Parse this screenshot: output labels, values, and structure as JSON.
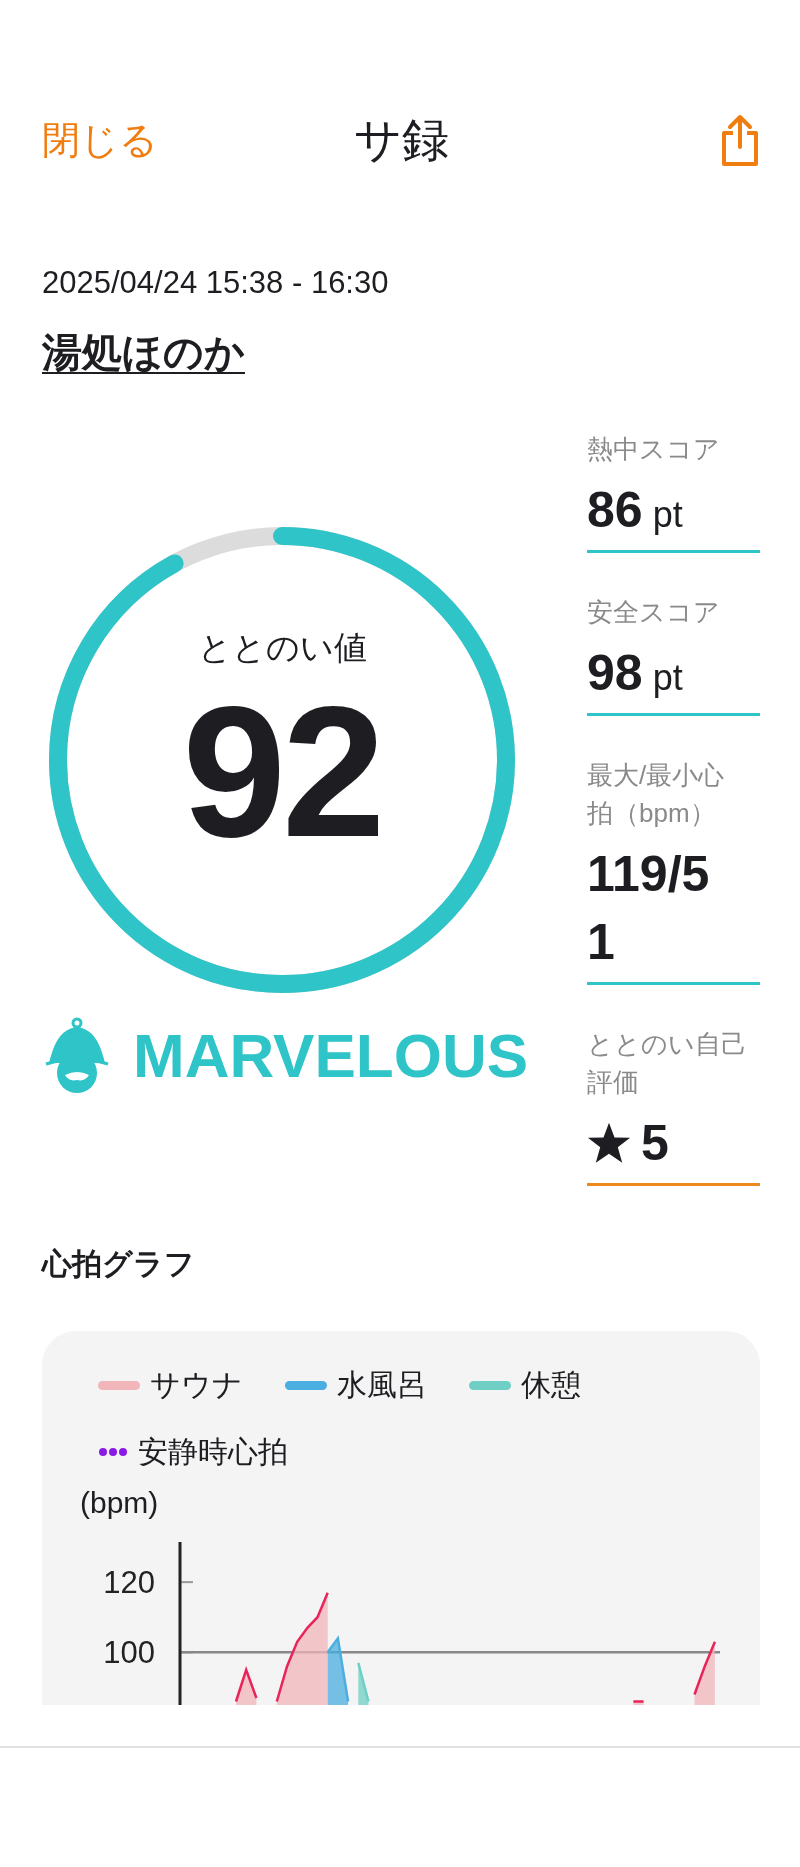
{
  "header": {
    "close": "閉じる",
    "title": "サ録"
  },
  "session": {
    "datetime": "2025/04/24 15:38 - 16:30",
    "venue": "湯処ほのか"
  },
  "score": {
    "label": "ととのい値",
    "value": "92",
    "level": 0.92,
    "rank": "MARVELOUS"
  },
  "stats": [
    {
      "kind": "score",
      "label": "熱中スコア",
      "value": "86",
      "unit": "pt"
    },
    {
      "kind": "score",
      "label": "安全スコア",
      "value": "98",
      "unit": "pt"
    },
    {
      "kind": "score",
      "label": "最大/最小心拍（bpm）",
      "value": "119/51"
    },
    {
      "kind": "rating",
      "label": "ととのい自己評価",
      "value": "5"
    }
  ],
  "heart_graph": {
    "title": "心拍グラフ",
    "chart_data": {
      "type": "area",
      "ylabel": "(bpm)",
      "ylim": [
        85,
        132
      ],
      "yticks": [
        {
          "value": 100,
          "label": "100"
        },
        {
          "value": 120,
          "label": "120"
        }
      ],
      "legend": "top",
      "series": [
        {
          "name": "サウナ",
          "color": "#f0b6ba",
          "values": [
            null,
            null,
            null,
            null,
            null,
            86,
            95,
            87,
            null,
            86,
            96,
            103,
            107,
            110,
            117,
            null,
            null,
            null,
            null,
            null,
            null,
            null,
            null,
            null,
            null,
            null,
            null,
            null,
            null,
            null,
            null,
            null,
            null,
            null,
            null,
            null,
            null,
            null,
            null,
            null,
            null,
            null,
            null,
            null,
            86,
            86,
            null,
            null,
            null,
            null,
            88,
            96,
            103
          ]
        },
        {
          "name": "水風呂",
          "color": "#4aaee0",
          "values": [
            null,
            null,
            null,
            null,
            null,
            null,
            null,
            null,
            null,
            null,
            null,
            null,
            null,
            null,
            100,
            104,
            86,
            null,
            null,
            null,
            null,
            null,
            null,
            null,
            null,
            null,
            null,
            null,
            null,
            null,
            null,
            null,
            null,
            null,
            null,
            null,
            null,
            null,
            null,
            null,
            null,
            null,
            null,
            null,
            null,
            null,
            null,
            null,
            null,
            null,
            null,
            null,
            null
          ]
        },
        {
          "name": "休憩",
          "color": "#6fcfc4",
          "values": [
            null,
            null,
            null,
            null,
            null,
            null,
            null,
            null,
            null,
            null,
            null,
            null,
            null,
            null,
            null,
            null,
            null,
            97,
            86,
            null,
            null,
            null,
            null,
            null,
            null,
            null,
            null,
            null,
            null,
            null,
            null,
            null,
            null,
            null,
            null,
            null,
            null,
            null,
            null,
            null,
            null,
            null,
            null,
            null,
            null,
            null,
            null,
            null,
            null,
            null,
            null,
            null,
            null
          ]
        }
      ]
    },
    "extra_legend": [
      {
        "kind": "dots",
        "label": "安静時心拍",
        "color": "#8a1be6"
      }
    ]
  }
}
